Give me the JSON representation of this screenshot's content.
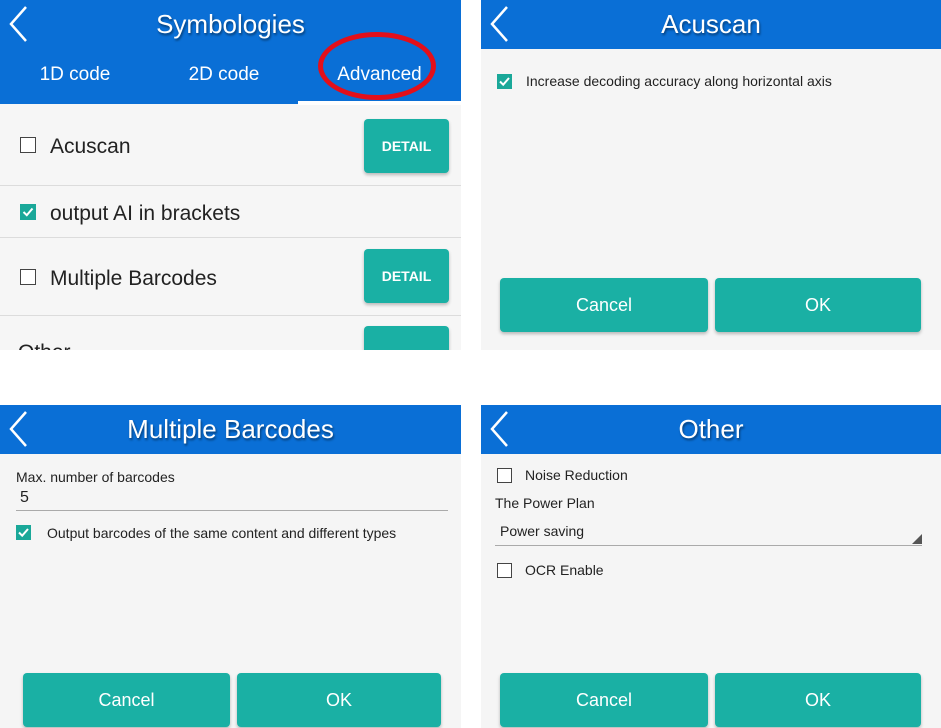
{
  "symbologies": {
    "title": "Symbologies",
    "tabs": [
      "1D code",
      "2D code",
      "Advanced"
    ],
    "rows": [
      {
        "label": "Acuscan",
        "checked": false,
        "button": "DETAIL"
      },
      {
        "label": "output AI in brackets",
        "checked": true
      },
      {
        "label": "Multiple Barcodes",
        "checked": false,
        "button": "DETAIL"
      },
      {
        "label": "Other"
      }
    ]
  },
  "acuscan": {
    "title": "Acuscan",
    "option": "Increase decoding accuracy along horizontal axis",
    "option_checked": true,
    "cancel": "Cancel",
    "ok": "OK"
  },
  "multiple_barcodes": {
    "title": "Multiple Barcodes",
    "max_label": "Max. number of barcodes",
    "max_value": "5",
    "option": "Output barcodes of the same content and different types",
    "option_checked": true,
    "cancel": "Cancel",
    "ok": "OK"
  },
  "other": {
    "title": "Other",
    "noise_reduction": "Noise Reduction",
    "noise_checked": false,
    "power_plan_label": "The Power Plan",
    "power_plan_value": "Power saving",
    "ocr_enable": "OCR Enable",
    "ocr_checked": false,
    "cancel": "Cancel",
    "ok": "OK"
  },
  "colors": {
    "header_blue": "#0a6fd6",
    "button_teal": "#1ab0a4",
    "check_teal": "#1aa899",
    "highlight_red": "#e30f1a"
  }
}
